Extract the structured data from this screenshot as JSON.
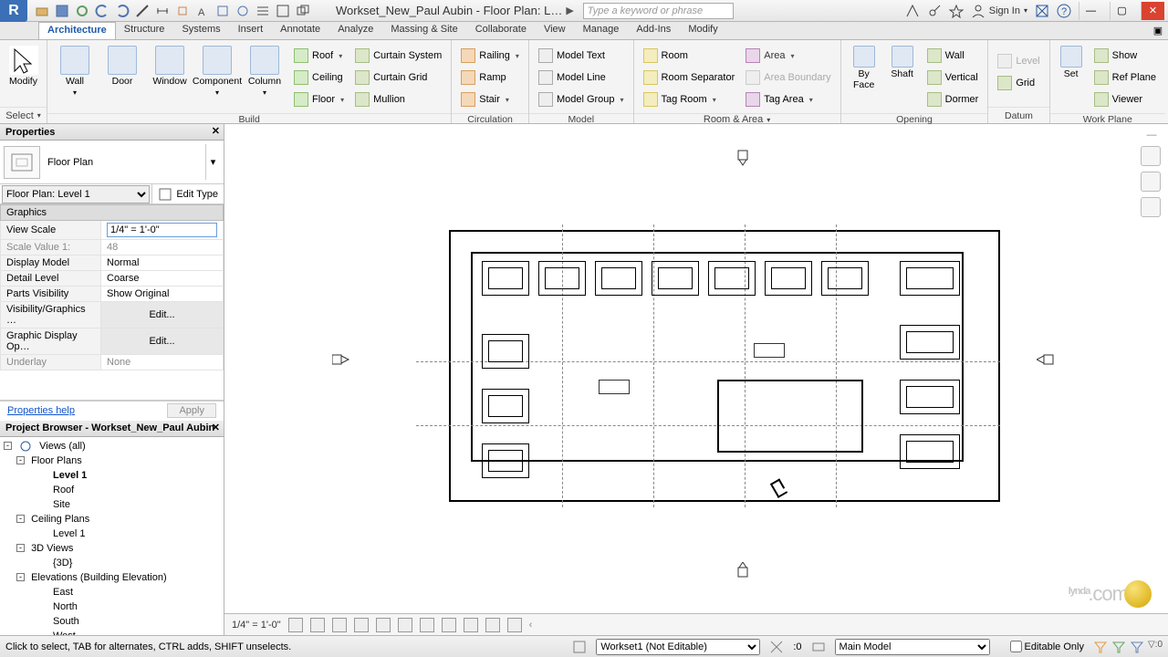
{
  "titlebar": {
    "document_title": "Workset_New_Paul Aubin - Floor Plan: L…",
    "search_placeholder": "Type a keyword or phrase",
    "signin_label": "Sign In"
  },
  "tabs": {
    "architecture": "Architecture",
    "structure": "Structure",
    "systems": "Systems",
    "insert": "Insert",
    "annotate": "Annotate",
    "analyze": "Analyze",
    "massing": "Massing & Site",
    "collaborate": "Collaborate",
    "view": "View",
    "manage": "Manage",
    "addins": "Add-Ins",
    "modify": "Modify"
  },
  "ribbon": {
    "select": {
      "modify": "Modify",
      "title": "Select"
    },
    "build": {
      "wall": "Wall",
      "door": "Door",
      "window": "Window",
      "component": "Component",
      "column": "Column",
      "roof": "Roof",
      "ceiling": "Ceiling",
      "floor": "Floor",
      "curtain_system": "Curtain System",
      "curtain_grid": "Curtain Grid",
      "mullion": "Mullion",
      "title": "Build"
    },
    "circulation": {
      "railing": "Railing",
      "ramp": "Ramp",
      "stair": "Stair",
      "title": "Circulation"
    },
    "model": {
      "model_text": "Model Text",
      "model_line": "Model Line",
      "model_group": "Model Group",
      "title": "Model"
    },
    "room_area": {
      "room": "Room",
      "room_separator": "Room Separator",
      "tag_room": "Tag Room",
      "area": "Area",
      "area_boundary": "Area Boundary",
      "tag_area": "Tag Area",
      "title": "Room & Area"
    },
    "opening": {
      "by_face": "By\nFace",
      "shaft": "Shaft",
      "wall": "Wall",
      "vertical": "Vertical",
      "dormer": "Dormer",
      "title": "Opening"
    },
    "datum": {
      "level": "Level",
      "grid": "Grid",
      "title": "Datum"
    },
    "workplane": {
      "set": "Set",
      "show": "Show",
      "ref_plane": "Ref Plane",
      "viewer": "Viewer",
      "title": "Work Plane"
    }
  },
  "properties": {
    "palette_title": "Properties",
    "type_name": "Floor Plan",
    "instance_selector": "Floor Plan: Level 1",
    "edit_type": "Edit Type",
    "group_graphics": "Graphics",
    "rows": {
      "view_scale": {
        "label": "View Scale",
        "value": "1/4\" = 1'-0\""
      },
      "scale_value": {
        "label": "Scale Value    1:",
        "value": "48"
      },
      "display_model": {
        "label": "Display Model",
        "value": "Normal"
      },
      "detail_level": {
        "label": "Detail Level",
        "value": "Coarse"
      },
      "parts_visibility": {
        "label": "Parts Visibility",
        "value": "Show Original"
      },
      "visibility_graphics": {
        "label": "Visibility/Graphics …",
        "value": "Edit..."
      },
      "graphic_display": {
        "label": "Graphic Display Op…",
        "value": "Edit..."
      },
      "underlay": {
        "label": "Underlay",
        "value": "None"
      }
    },
    "help_link": "Properties help",
    "apply": "Apply"
  },
  "project_browser": {
    "title": "Project Browser - Workset_New_Paul Aubin",
    "views_all": "Views (all)",
    "floor_plans": "Floor Plans",
    "level1": "Level 1",
    "roof": "Roof",
    "site": "Site",
    "ceiling_plans": "Ceiling Plans",
    "cp_level1": "Level 1",
    "threed_views": "3D Views",
    "threed": "{3D}",
    "elevations": "Elevations (Building Elevation)",
    "east": "East",
    "north": "North",
    "south": "South",
    "west": "West"
  },
  "viewbar": {
    "scale": "1/4\" = 1'-0\""
  },
  "status": {
    "hint": "Click to select, TAB for alternates, CTRL adds, SHIFT unselects.",
    "workset": "Workset1 (Not Editable)",
    "excluded": ":0",
    "main_model": "Main Model",
    "editable_only": "Editable Only"
  },
  "watermark": {
    "brand": "lynda",
    "tld": ".com"
  }
}
